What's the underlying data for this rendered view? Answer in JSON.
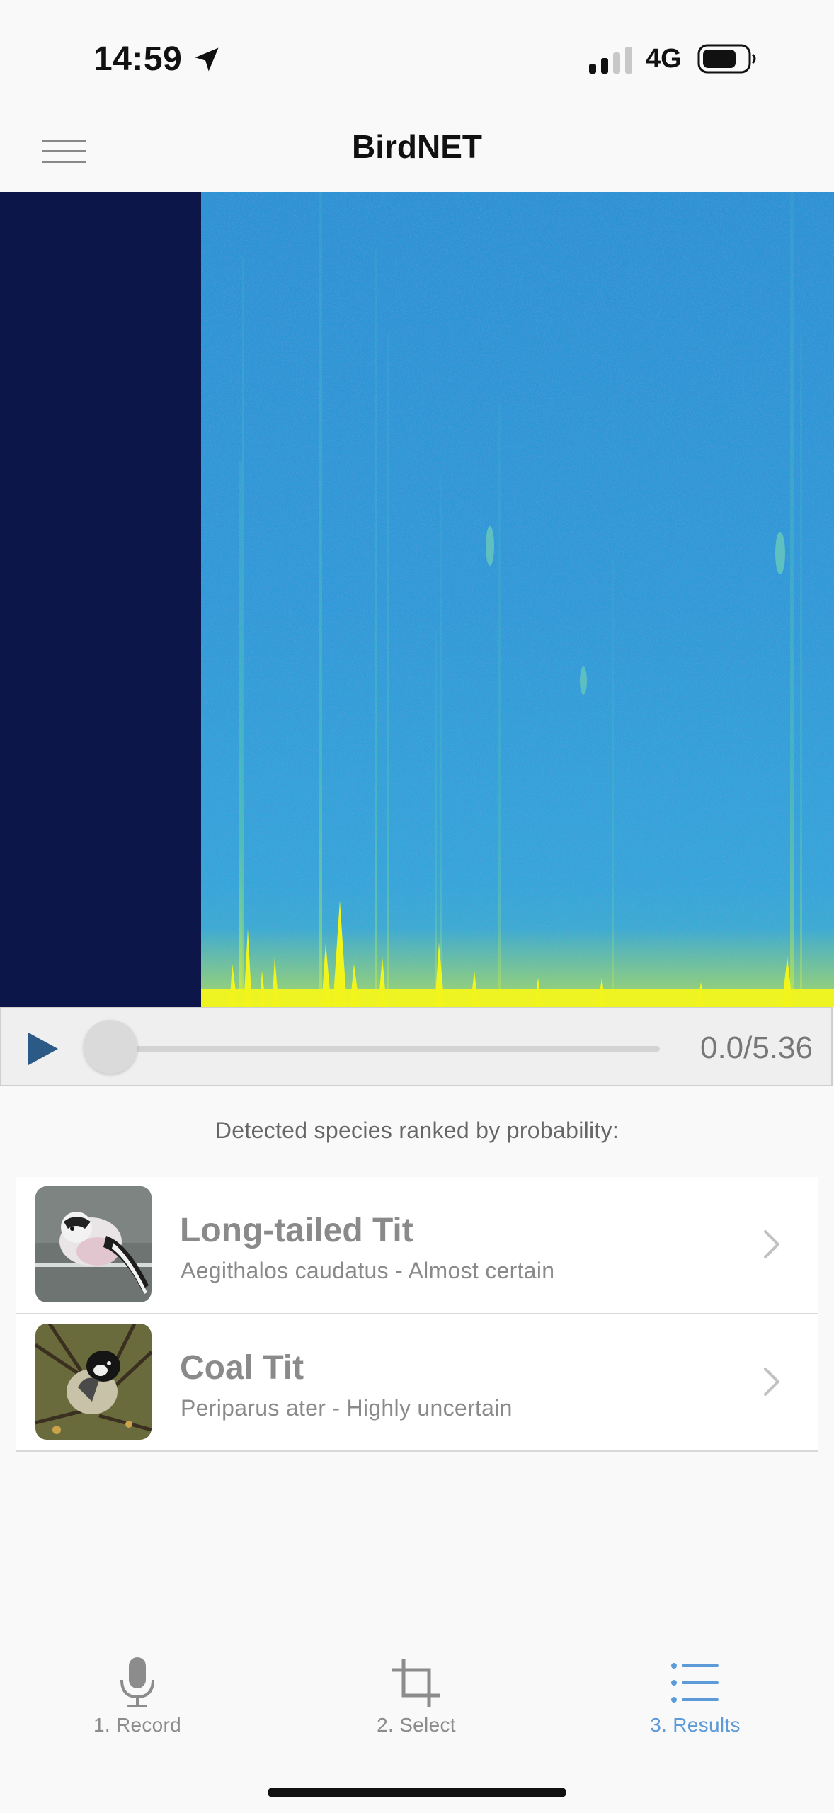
{
  "status_bar": {
    "time": "14:59",
    "network": "4G"
  },
  "header": {
    "title": "BirdNET"
  },
  "player": {
    "time": "0.0/5.36",
    "position_fraction": 0.0
  },
  "results": {
    "heading": "Detected species ranked by probability:",
    "items": [
      {
        "common_name": "Long-tailed Tit",
        "scientific_line": "Aegithalos caudatus - Almost certain",
        "thumbnail_icon": "long-tailed-tit-photo"
      },
      {
        "common_name": "Coal Tit",
        "scientific_line": "Periparus ater - Highly uncertain",
        "thumbnail_icon": "coal-tit-photo"
      }
    ]
  },
  "tab_bar": {
    "tabs": [
      {
        "label": "1. Record",
        "icon": "microphone-icon",
        "active": false
      },
      {
        "label": "2. Select",
        "icon": "crop-icon",
        "active": false
      },
      {
        "label": "3. Results",
        "icon": "list-icon",
        "active": true
      }
    ]
  },
  "colors": {
    "accent": "#5d9ad8",
    "spectrogram_background": "#0d1648",
    "spectrogram_base": "#2f9fd6",
    "spectrogram_high": "#f5f523",
    "inactive_text": "#8a8a8a"
  }
}
